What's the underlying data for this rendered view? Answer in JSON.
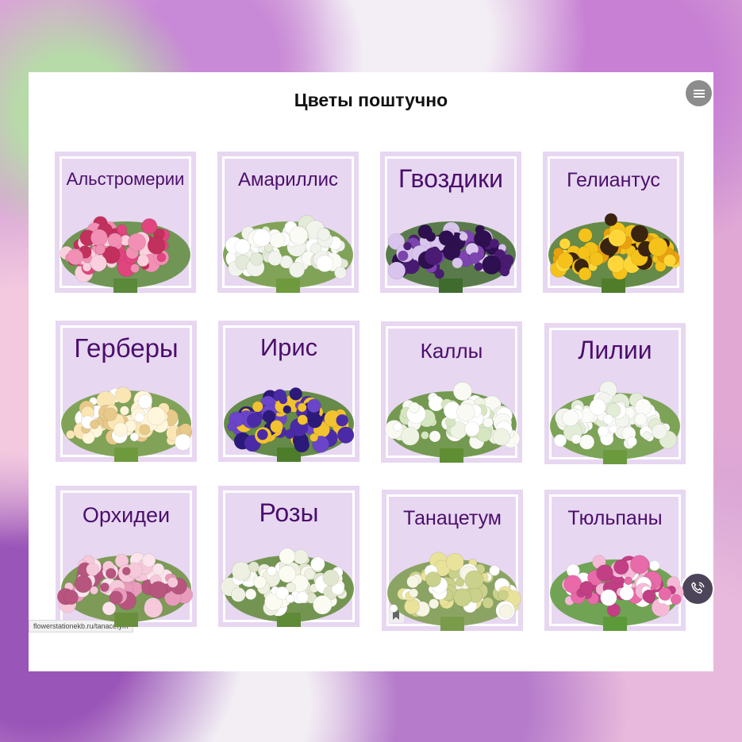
{
  "page": {
    "title": "Цветы поштучно",
    "status_url": "flowerstationekb.ru/tanacetym"
  },
  "menu_icon": "hamburger-menu-icon",
  "call_icon": "phone-call-icon",
  "bookmark_icon": "bookmark-icon",
  "tiles": [
    {
      "label": "Альстромерии",
      "colors": [
        "#f28fb4",
        "#e0457e",
        "#fbd0de",
        "#c2305e"
      ],
      "leaf": "#5b8a3a"
    },
    {
      "label": "Амариллис",
      "colors": [
        "#ffffff",
        "#f1f4ec",
        "#e3ead8",
        "#fbfbf5"
      ],
      "leaf": "#6f9a3d"
    },
    {
      "label": "Гвоздики",
      "colors": [
        "#4a1b73",
        "#7d44b0",
        "#d8c4ec",
        "#2e0f4f"
      ],
      "leaf": "#3f6b2e"
    },
    {
      "label": "Гелиантус",
      "colors": [
        "#f5c21b",
        "#e8a10f",
        "#3a2410",
        "#ffd63a"
      ],
      "leaf": "#4f7d2a"
    },
    {
      "label": "Герберы",
      "colors": [
        "#fff6dc",
        "#fae6b5",
        "#ffffff",
        "#e7c98a"
      ],
      "leaf": "#6f9a3d"
    },
    {
      "label": "Ирис",
      "colors": [
        "#4b2aa8",
        "#6b45c9",
        "#2b1a7a",
        "#f2c230"
      ],
      "leaf": "#4d7d2c"
    },
    {
      "label": "Каллы",
      "colors": [
        "#ffffff",
        "#eef3e4",
        "#d6e6c0",
        "#f8faf3"
      ],
      "leaf": "#5f8e34"
    },
    {
      "label": "Лилии",
      "colors": [
        "#ffffff",
        "#f3f6ee",
        "#e2ecd6",
        "#fbfcf8"
      ],
      "leaf": "#6a9a3c"
    },
    {
      "label": "Орхидеи",
      "colors": [
        "#f6c9da",
        "#e99bbb",
        "#fbe4ec",
        "#b7557f"
      ],
      "leaf": "#6a8f3c"
    },
    {
      "label": "Розы",
      "colors": [
        "#fbfbf2",
        "#eef0e2",
        "#ffffff",
        "#e1e6cf"
      ],
      "leaf": "#5f8a36"
    },
    {
      "label": "Танацетум",
      "colors": [
        "#f7f5e4",
        "#e9e29a",
        "#c9d18a",
        "#ffffff"
      ],
      "leaf": "#7a9b4a"
    },
    {
      "label": "Тюльпаны",
      "colors": [
        "#e86aa8",
        "#f5b9d6",
        "#ffffff",
        "#c23f85"
      ],
      "leaf": "#5c9a3a"
    }
  ]
}
